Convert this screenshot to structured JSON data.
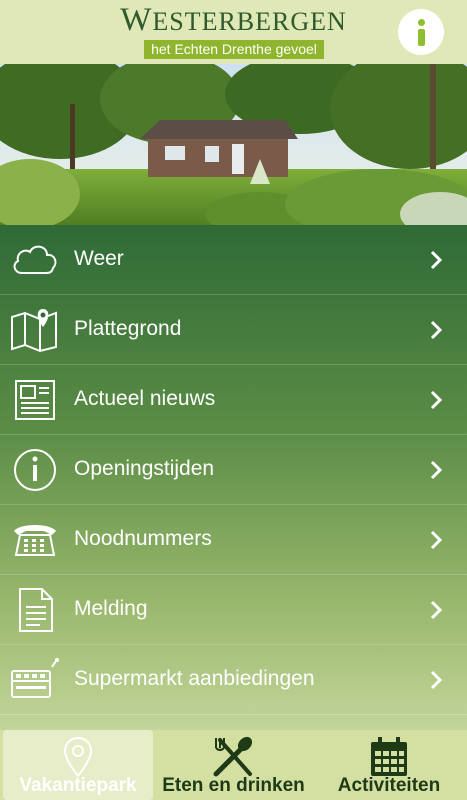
{
  "header": {
    "logo_initial": "W",
    "logo_rest": "ESTERBERGEN",
    "tagline": "het Echten Drenthe gevoel",
    "info_icon": "info-icon",
    "colors": {
      "brand_green": "#2f5a2e",
      "accent": "#8eb52d"
    }
  },
  "photo": {
    "alt": "bungalow"
  },
  "menu": {
    "items": [
      {
        "label": "Weer",
        "icon": "cloud-icon"
      },
      {
        "label": "Plattegrond",
        "icon": "map-icon"
      },
      {
        "label": "Actueel nieuws",
        "icon": "newspaper-icon"
      },
      {
        "label": "Openingstijden",
        "icon": "info-circle-icon"
      },
      {
        "label": "Noodnummers",
        "icon": "phone-icon"
      },
      {
        "label": "Melding",
        "icon": "document-icon"
      },
      {
        "label": "Supermarkt aanbiedingen",
        "icon": "register-icon"
      }
    ]
  },
  "tabs": [
    {
      "label": "Vakantiepark",
      "icon": "map-pin-icon",
      "active": true
    },
    {
      "label": "Eten en drinken",
      "icon": "utensils-icon",
      "active": false
    },
    {
      "label": "Activiteiten",
      "icon": "calendar-icon",
      "active": false
    }
  ]
}
